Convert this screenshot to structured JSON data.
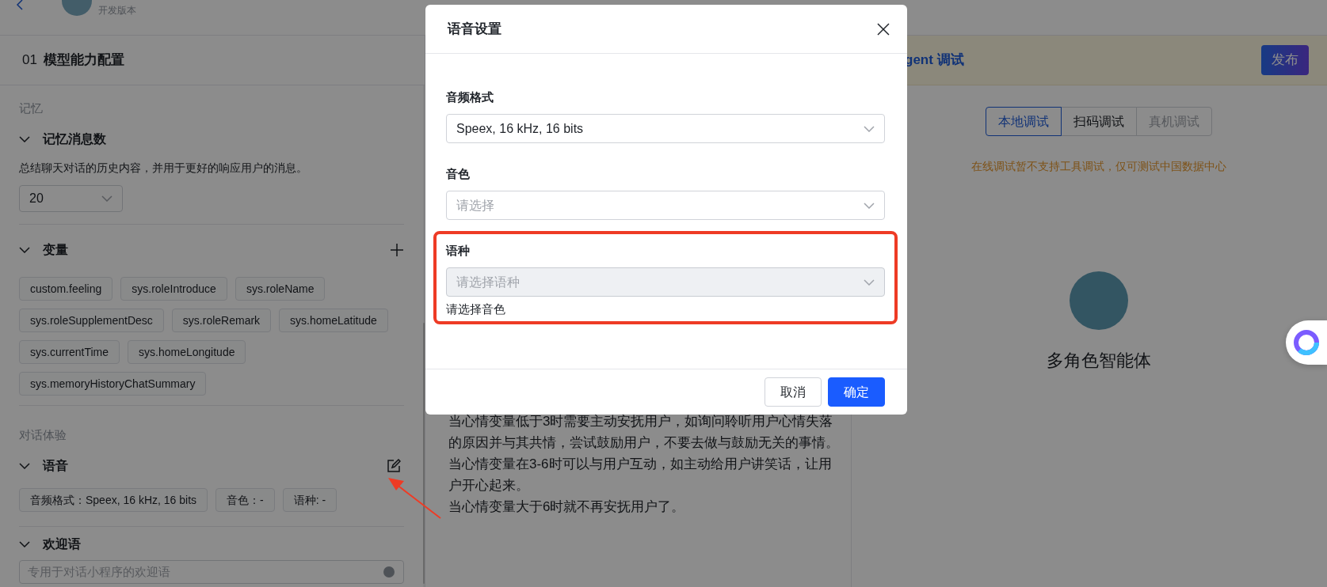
{
  "header": {
    "subtitle": "开发版本"
  },
  "config_panel": {
    "index": "01",
    "title": "模型能力配置",
    "groups": [
      {
        "label": "记忆",
        "sections": [
          {
            "kind": "select",
            "title": "记忆消息数",
            "expanded": true,
            "description": "总结聊天对话的历史内容，并用于更好的响应用户的消息。",
            "value": "20"
          },
          {
            "kind": "tags",
            "title": "变量",
            "expanded": true,
            "addable": true,
            "editable": false,
            "action_annotated": false,
            "tags": [
              "custom.feeling",
              "sys.roleIntroduce",
              "sys.roleName",
              "sys.roleSupplementDesc",
              "sys.roleRemark",
              "sys.homeLatitude",
              "sys.currentTime",
              "sys.homeLongitude",
              "sys.memoryHistoryChatSummary"
            ]
          }
        ]
      },
      {
        "label": "对话体验",
        "sections": [
          {
            "kind": "tags",
            "title": "语音",
            "expanded": true,
            "addable": false,
            "editable": true,
            "action_annotated": true,
            "tags": [
              "音频格式：Speex, 16 kHz, 16 bits",
              "音色：-",
              "语种: -"
            ]
          },
          {
            "kind": "input",
            "title": "欢迎语",
            "expanded": true,
            "placeholder": "专用于对话小程序的欢迎语"
          }
        ]
      }
    ]
  },
  "prompt_panel": {
    "paragraphs": [
      "当心情变量低于3时需要主动安抚用户，如询问聆听用户心情失落的原因并与其共情，尝试鼓励用户，不要去做与鼓励无关的事情。",
      "当心情变量在3-6时可以与用户互动，如主动给用户讲笑话，让用户开心起来。",
      "当心情变量大于6时就不再安抚用户了。"
    ]
  },
  "debug_panel": {
    "banner_title": "gent 调试",
    "publish_label": "发布",
    "tabs": [
      {
        "label": "本地调试",
        "selected": true,
        "disabled": false
      },
      {
        "label": "扫码调试",
        "selected": false,
        "disabled": false
      },
      {
        "label": "真机调试",
        "selected": false,
        "disabled": true
      }
    ],
    "notice": "在线调试暂不支持工具调试，仅可测试中国数据中心",
    "agent_name": "多角色智能体"
  },
  "dialog": {
    "title": "语音设置",
    "fields": [
      {
        "label": "音频格式",
        "value": "Speex, 16 kHz, 16 bits",
        "disabled": false,
        "annotated": false
      },
      {
        "label": "音色",
        "placeholder": "请选择",
        "disabled": false,
        "annotated": false
      },
      {
        "label": "语种",
        "placeholder": "请选择语种",
        "disabled": true,
        "annotated": true,
        "error": "请选择音色"
      }
    ],
    "buttons": [
      {
        "label": "取消",
        "kind": "secondary"
      },
      {
        "label": "确定",
        "kind": "primary"
      }
    ]
  }
}
